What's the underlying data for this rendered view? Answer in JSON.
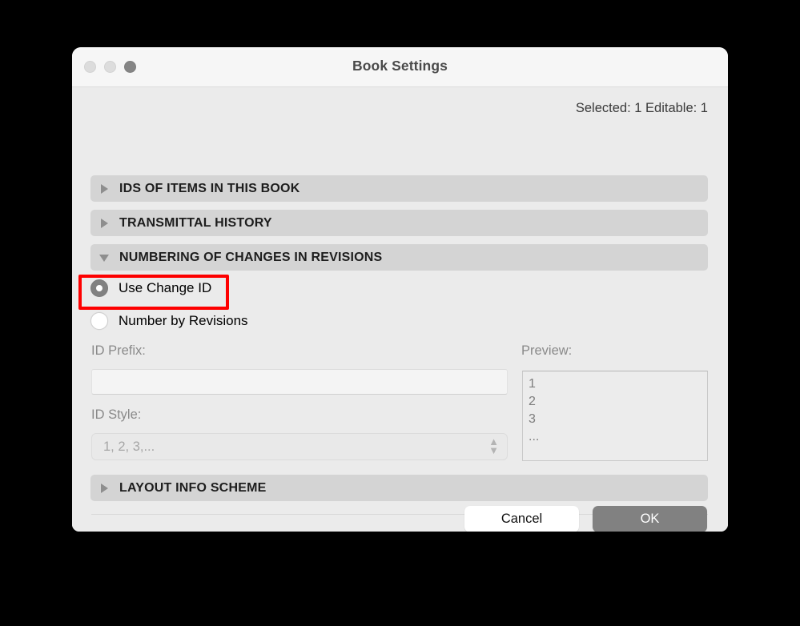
{
  "window": {
    "title": "Book Settings",
    "traffic_lights": [
      "close",
      "minimize",
      "zoom"
    ]
  },
  "status": {
    "text": "Selected: 1 Editable: 1"
  },
  "sections": [
    {
      "label": "IDS OF ITEMS IN THIS BOOK",
      "expanded": false
    },
    {
      "label": "TRANSMITTAL HISTORY",
      "expanded": false
    },
    {
      "label": "NUMBERING OF CHANGES IN REVISIONS",
      "expanded": true
    },
    {
      "label": "LAYOUT INFO SCHEME",
      "expanded": false
    }
  ],
  "numbering": {
    "options": [
      {
        "label": "Use Change ID",
        "selected": true,
        "highlighted": true
      },
      {
        "label": "Number by Revisions",
        "selected": false,
        "highlighted": false
      }
    ],
    "id_prefix": {
      "label": "ID Prefix:",
      "value": "",
      "enabled": false
    },
    "id_style": {
      "label": "ID Style:",
      "value": "1, 2, 3,...",
      "enabled": false
    },
    "preview": {
      "label": "Preview:",
      "lines": [
        "1",
        "2",
        "3",
        "..."
      ]
    }
  },
  "footer": {
    "cancel_label": "Cancel",
    "ok_label": "OK"
  },
  "colors": {
    "highlight": "#fe0000",
    "window_background": "#ebebeb",
    "section_header": "#d4d4d4",
    "default_button": "#818181"
  }
}
